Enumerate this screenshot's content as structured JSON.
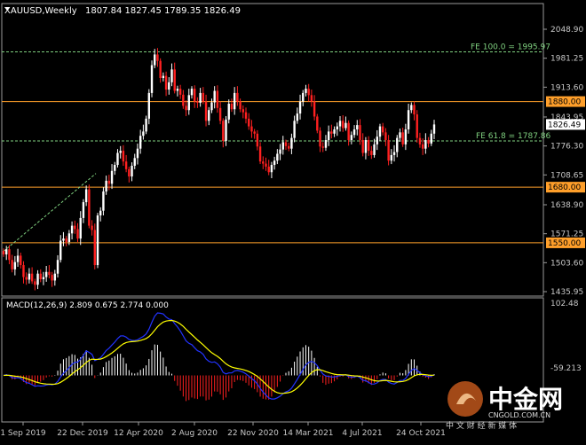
{
  "header": {
    "symbol_label": "XAUUSD,Weekly",
    "ohlc": "1807.84 1827.45 1789.35 1826.49"
  },
  "price_axis": {
    "ticks": [
      "2048.90",
      "1981.25",
      "1913.60",
      "1843.95",
      "1776.30",
      "1708.65",
      "1638.90",
      "1571.25",
      "1503.60",
      "1435.95"
    ],
    "current_price": "1826.49"
  },
  "levels": [
    {
      "label": "FE 100.0 = 1995.97",
      "kind": "fib",
      "color": "#7fd07f",
      "value": 1995.97
    },
    {
      "label": "FE 61.8 = 1787.86",
      "kind": "fib",
      "color": "#7fd07f",
      "value": 1787.86
    },
    {
      "label": "1880.00",
      "kind": "hline",
      "color": "#ff9f2a",
      "value": 1880.0
    },
    {
      "label": "1680.00",
      "kind": "hline",
      "color": "#ff9f2a",
      "value": 1680.0
    },
    {
      "label": "1550.00",
      "kind": "hline",
      "color": "#ff9f2a",
      "value": 1550.0
    }
  ],
  "date_axis": {
    "ticks": [
      "1 Sep 2019",
      "22 Dec 2019",
      "12 Apr 2020",
      "2 Aug 2020",
      "22 Nov 2020",
      "14 Mar 2021",
      "4 Jul 2021",
      "24 Oct 2021"
    ]
  },
  "macd": {
    "label": "MACD(12,26,9) 2.809 0.675 2.774 0.000",
    "axis_top": "102.48",
    "axis_bottom": "-59.213"
  },
  "watermark": {
    "title": "中金网",
    "subtitle": "中 文 财 经 新 媒 体",
    "url": "CNGOLD.COM.CN"
  },
  "colors": {
    "background": "#000000",
    "bull": "#ffffff",
    "bear": "#ff2020",
    "signal": "#ffff00",
    "macd_line": "#2233ff",
    "level_orange": "#ff9f2a",
    "fib_green": "#7fd07f",
    "grid_text": "#c8c8c8"
  },
  "chart_data": {
    "type": "candlestick",
    "symbol": "XAUUSD",
    "timeframe": "Weekly",
    "closes": [
      1523,
      1535,
      1510,
      1488,
      1505,
      1520,
      1498,
      1470,
      1464,
      1478,
      1460,
      1452,
      1478,
      1465,
      1470,
      1482,
      1475,
      1462,
      1478,
      1510,
      1555,
      1560,
      1552,
      1572,
      1590,
      1582,
      1560,
      1608,
      1645,
      1675,
      1590,
      1580,
      1498,
      1614,
      1625,
      1670,
      1695,
      1688,
      1718,
      1732,
      1760,
      1765,
      1740,
      1722,
      1705,
      1730,
      1748,
      1770,
      1800,
      1810,
      1840,
      1900,
      1965,
      1990,
      1975,
      1935,
      1940,
      1908,
      1925,
      1955,
      1905,
      1910,
      1896,
      1870,
      1860,
      1895,
      1910,
      1880,
      1877,
      1900,
      1880,
      1835,
      1860,
      1878,
      1905,
      1865,
      1835,
      1788,
      1838,
      1875,
      1862,
      1900,
      1880,
      1862,
      1855,
      1840,
      1822,
      1810,
      1805,
      1775,
      1740,
      1735,
      1728,
      1715,
      1732,
      1742,
      1758,
      1768,
      1785,
      1776,
      1770,
      1795,
      1835,
      1852,
      1880,
      1900,
      1910,
      1895,
      1880,
      1845,
      1812,
      1775,
      1772,
      1790,
      1810,
      1805,
      1815,
      1822,
      1835,
      1818,
      1830,
      1790,
      1802,
      1815,
      1825,
      1790,
      1760,
      1790,
      1765,
      1755,
      1780,
      1798,
      1822,
      1808,
      1790,
      1742,
      1755,
      1762,
      1795,
      1808,
      1780,
      1815,
      1860,
      1872,
      1850,
      1795,
      1780,
      1770,
      1790,
      1782,
      1805,
      1826.49
    ]
  }
}
